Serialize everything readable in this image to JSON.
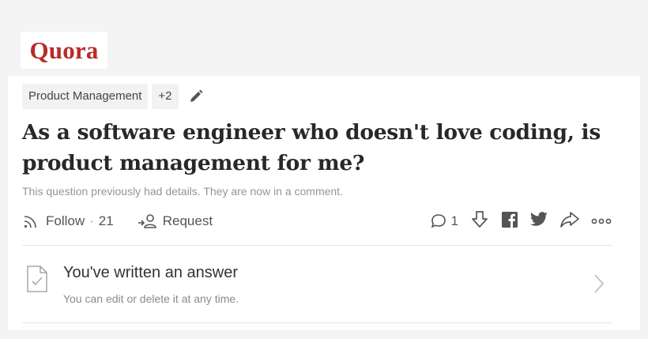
{
  "brand": {
    "logo_text": "Quora",
    "color": "#b92b27"
  },
  "topics": {
    "primary": "Product Management",
    "more": "+2"
  },
  "question": {
    "title": "As a software engineer who doesn't love coding, is product management for me?",
    "details_note": "This question previously had details. They are now in a comment."
  },
  "actions": {
    "follow_label": "Follow",
    "follow_separator": "·",
    "follow_count": "21",
    "request_label": "Request",
    "comment_count": "1"
  },
  "answer_notice": {
    "title": "You've written an answer",
    "subtitle": "You can edit or delete it at any time."
  },
  "icons": [
    "edit-pencil-icon",
    "follow-rss-icon",
    "request-person-icon",
    "comment-icon",
    "downvote-icon",
    "facebook-icon",
    "twitter-icon",
    "share-icon",
    "more-icon",
    "document-check-icon",
    "chevron-right-icon"
  ]
}
